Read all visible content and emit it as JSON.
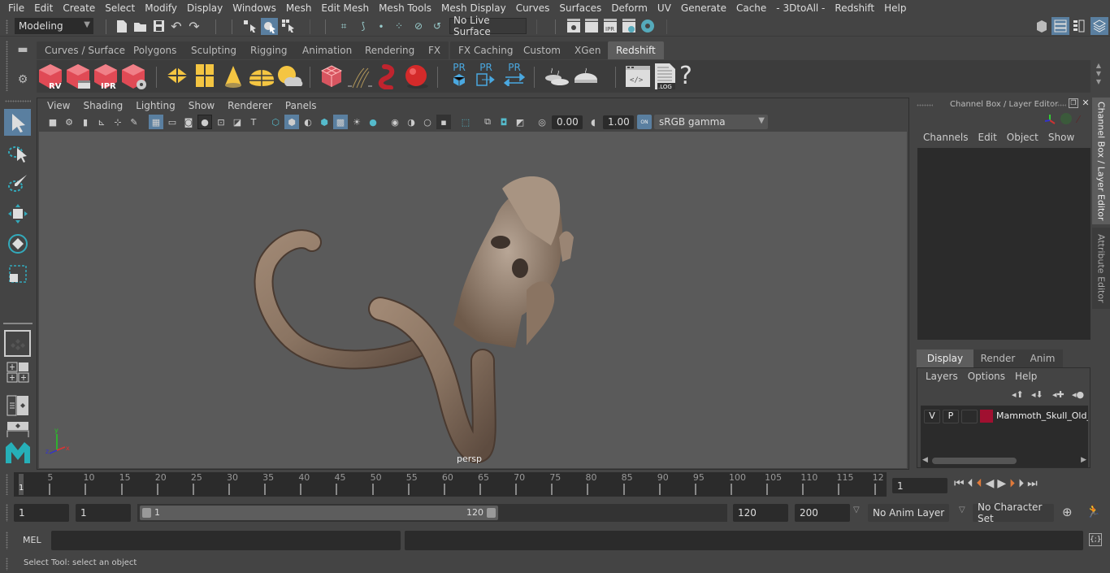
{
  "menubar": {
    "items": [
      "File",
      "Edit",
      "Create",
      "Select",
      "Modify",
      "Display",
      "Windows",
      "Mesh",
      "Edit Mesh",
      "Mesh Tools",
      "Mesh Display",
      "Curves",
      "Surfaces",
      "Deform",
      "UV",
      "Generate",
      "Cache",
      "- 3DtoAll -",
      "Redshift",
      "Help"
    ]
  },
  "statusline": {
    "mode_dropdown": "Modeling",
    "live_surface": "No Live Surface",
    "icons": [
      "new-scene-icon",
      "open-scene-icon",
      "save-scene-icon",
      "undo-icon",
      "redo-icon",
      "select-hierarchy-icon",
      "select-object-icon",
      "select-component-icon",
      "snap-grid-icon",
      "snap-curve-icon",
      "snap-point-icon",
      "snap-view-plane-icon",
      "snap-live-icon",
      "symmetry-icon",
      "render-view-icon",
      "render-current-icon",
      "ipr-render-icon",
      "render-settings-icon",
      "hypershade-icon"
    ],
    "right_icons": [
      "modeling-toolkit-icon",
      "attribute-editor-icon",
      "tool-settings-icon",
      "channel-box-icon"
    ]
  },
  "shelf": {
    "tabs": [
      "Curves / Surfaces",
      "Polygons",
      "Sculpting",
      "Rigging",
      "Animation",
      "Rendering",
      "FX",
      "FX Caching",
      "Custom",
      "XGen",
      "Redshift"
    ],
    "active_tab": "Redshift",
    "buttons": [
      {
        "name": "rs-render-view",
        "label": "RV"
      },
      {
        "name": "rs-batch-render",
        "label": ""
      },
      {
        "name": "rs-ipr",
        "label": "IPR"
      },
      {
        "name": "rs-render-settings",
        "label": ""
      },
      {
        "name": "rs-area-light",
        "label": ""
      },
      {
        "name": "rs-portal-light",
        "label": ""
      },
      {
        "name": "rs-spot-light",
        "label": ""
      },
      {
        "name": "rs-dome-light",
        "label": ""
      },
      {
        "name": "rs-sun-sky",
        "label": ""
      },
      {
        "name": "rs-volume",
        "label": ""
      },
      {
        "name": "rs-hair",
        "label": ""
      },
      {
        "name": "rs-mesh-light",
        "label": ""
      },
      {
        "name": "rs-sphere-light",
        "label": ""
      },
      {
        "name": "rs-proxy-create",
        "label": "PR"
      },
      {
        "name": "rs-proxy-export",
        "label": "PR"
      },
      {
        "name": "rs-proxy-import",
        "label": "PR"
      },
      {
        "name": "rs-bake-1",
        "label": ""
      },
      {
        "name": "rs-bake-2",
        "label": ""
      },
      {
        "name": "rs-script-console",
        "label": ""
      },
      {
        "name": "rs-log",
        "label": ".LOG"
      },
      {
        "name": "rs-help",
        "label": "?"
      }
    ]
  },
  "viewport": {
    "menu": [
      "View",
      "Shading",
      "Lighting",
      "Show",
      "Renderer",
      "Panels"
    ],
    "exposure": "0.00",
    "gamma": "1.00",
    "color_mgmt_toggle": "ON",
    "color_space": "sRGB gamma",
    "camera_label": "persp",
    "axis": {
      "x": "x",
      "y": "y",
      "z": "z"
    }
  },
  "channel_box": {
    "title": "Channel Box / Layer Editor",
    "menu": [
      "Channels",
      "Edit",
      "Object",
      "Show"
    ]
  },
  "layer_editor": {
    "tabs": [
      "Display",
      "Render",
      "Anim"
    ],
    "active_tab": "Display",
    "menu": [
      "Layers",
      "Options",
      "Help"
    ],
    "layers": [
      {
        "visible": "V",
        "playback": "P",
        "type": "",
        "color": "#a01030",
        "name": "Mammoth_Skull_Old_E"
      }
    ]
  },
  "side_tabs": [
    "Channel Box / Layer Editor",
    "Attribute Editor"
  ],
  "timeline": {
    "ticks": [
      "5",
      "10",
      "15",
      "20",
      "25",
      "30",
      "35",
      "40",
      "45",
      "50",
      "55",
      "60",
      "65",
      "70",
      "75",
      "80",
      "85",
      "90",
      "95",
      "100",
      "105",
      "110",
      "115",
      "12"
    ],
    "current_frame_marker": "1",
    "current_frame_field": "1"
  },
  "range": {
    "start_field": "1",
    "playback_start": "1",
    "slider_start": "1",
    "slider_end": "120",
    "playback_end": "120",
    "end_field": "200",
    "anim_layer": "No Anim Layer",
    "character_set": "No Character Set"
  },
  "command_line": {
    "label": "MEL",
    "value": ""
  },
  "help_line": {
    "text": "Select Tool: select an object"
  }
}
